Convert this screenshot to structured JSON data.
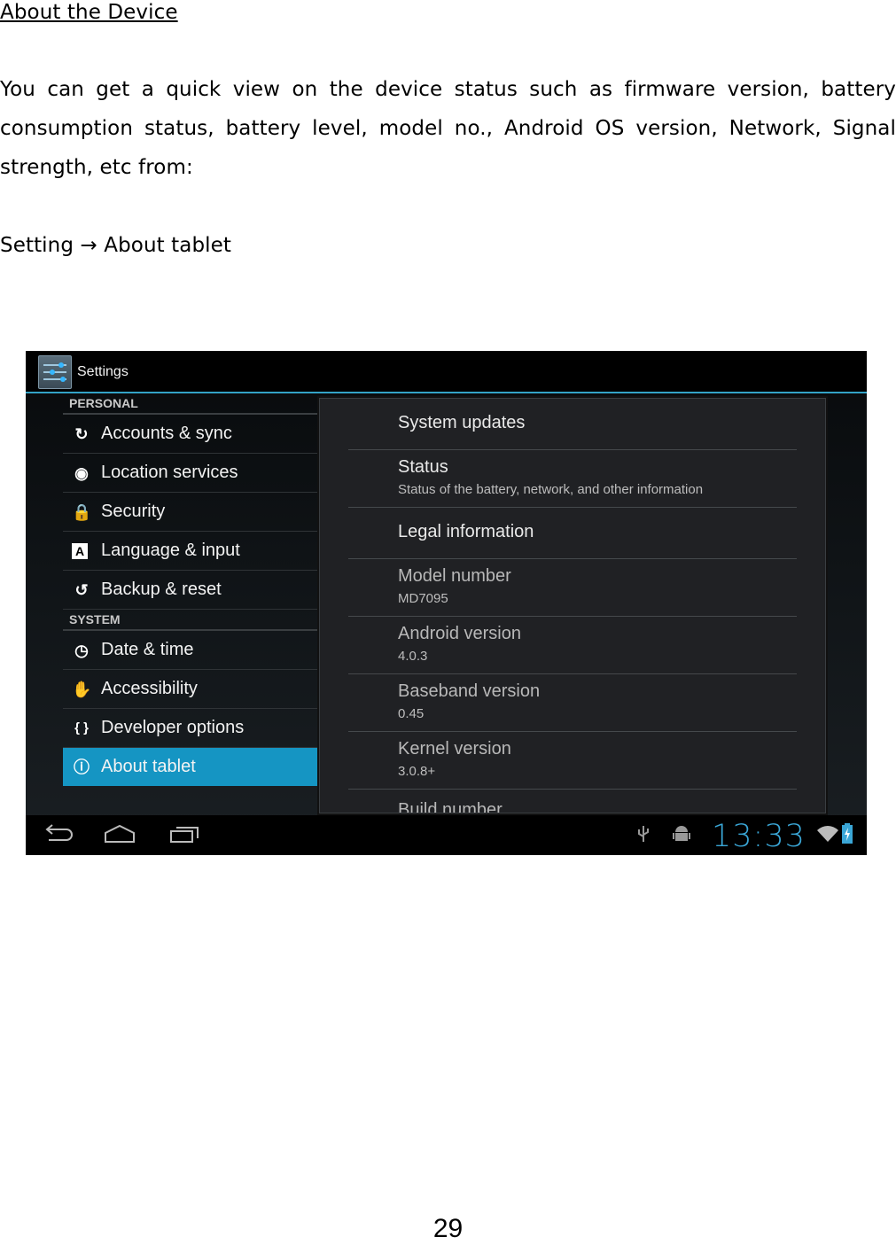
{
  "document": {
    "heading": "About the Device",
    "paragraph": "You can get a quick view on the device status such as firmware version, battery consumption status, battery level, model no., Android OS version, Network, Signal strength, etc from:",
    "path": "Setting → About tablet",
    "page_number": "29"
  },
  "screenshot": {
    "app_title": "Settings",
    "left_pane": {
      "sections": [
        {
          "label": "PERSONAL",
          "items": [
            {
              "label": "Accounts & sync",
              "icon": "sync-icon",
              "glyph": "↻"
            },
            {
              "label": "Location services",
              "icon": "location-icon",
              "glyph": "◉"
            },
            {
              "label": "Security",
              "icon": "lock-icon",
              "glyph": "🔒"
            },
            {
              "label": "Language & input",
              "icon": "language-icon",
              "glyph": "A"
            },
            {
              "label": "Backup & reset",
              "icon": "backup-icon",
              "glyph": "↺"
            }
          ]
        },
        {
          "label": "SYSTEM",
          "items": [
            {
              "label": "Date & time",
              "icon": "clock-icon",
              "glyph": "◷"
            },
            {
              "label": "Accessibility",
              "icon": "hand-icon",
              "glyph": "✋"
            },
            {
              "label": "Developer options",
              "icon": "braces-icon",
              "glyph": "{ }"
            },
            {
              "label": "About tablet",
              "icon": "info-icon",
              "glyph": "ⓘ",
              "selected": true
            }
          ]
        }
      ]
    },
    "right_pane": {
      "items": [
        {
          "title": "System updates",
          "summary": ""
        },
        {
          "title": "Status",
          "summary": "Status of the battery, network, and other information"
        },
        {
          "title": "Legal information",
          "summary": ""
        },
        {
          "title": "Model number",
          "summary": "MD7095"
        },
        {
          "title": "Android version",
          "summary": "4.0.3"
        },
        {
          "title": "Baseband version",
          "summary": "0.45"
        },
        {
          "title": "Kernel version",
          "summary": "3.0.8+"
        },
        {
          "title": "Build number",
          "summary": ""
        }
      ]
    },
    "status_bar": {
      "time": "13:33",
      "accent_color": "#33a3c6",
      "icons": [
        "usb-icon",
        "android-debug-icon",
        "wifi-icon",
        "battery-charging-icon"
      ]
    },
    "nav_buttons": [
      "back-button",
      "home-button",
      "recent-apps-button"
    ]
  }
}
